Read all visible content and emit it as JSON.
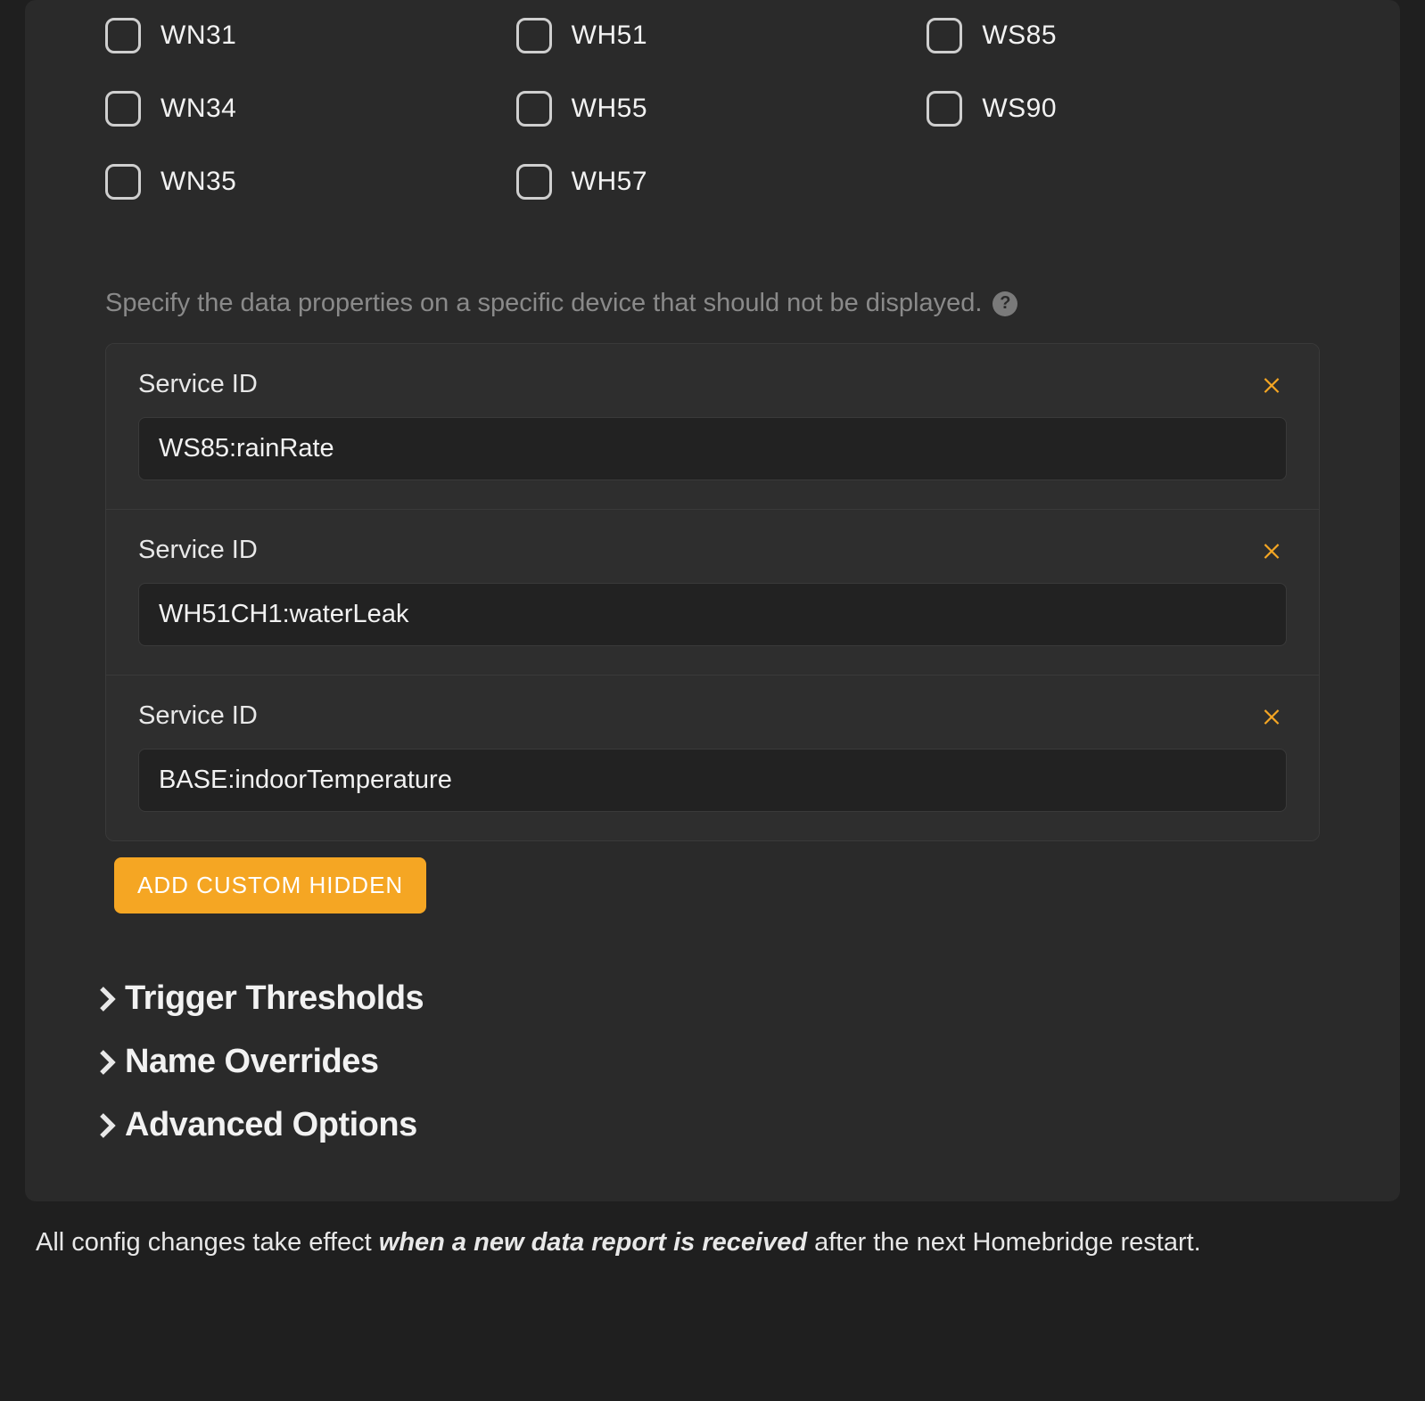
{
  "checkboxes": {
    "col1": [
      "WN31",
      "WN34",
      "WN35"
    ],
    "col2": [
      "WH51",
      "WH55",
      "WH57"
    ],
    "col3": [
      "WS85",
      "WS90"
    ]
  },
  "help": {
    "text": "Specify the data properties on a specific device that should not be displayed."
  },
  "service_id_label": "Service ID",
  "services": [
    {
      "value": "WS85:rainRate"
    },
    {
      "value": "WH51CH1:waterLeak"
    },
    {
      "value": "BASE:indoorTemperature"
    }
  ],
  "buttons": {
    "add_custom_hidden": "ADD CUSTOM HIDDEN"
  },
  "accordions": [
    "Trigger Thresholds",
    "Name Overrides",
    "Advanced Options"
  ],
  "footer": {
    "prefix": "All config changes take effect ",
    "emphasis": "when a new data report is received",
    "suffix": " after the next Homebridge restart."
  }
}
